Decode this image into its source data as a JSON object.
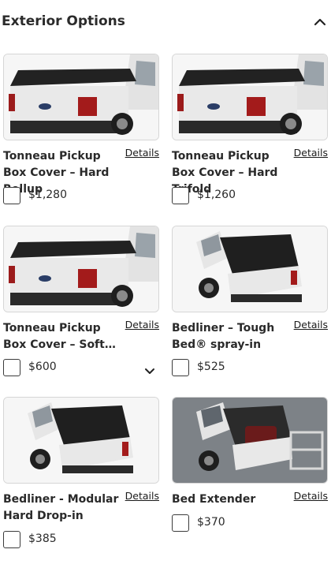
{
  "section": {
    "title": "Exterior Options"
  },
  "options": [
    {
      "name": "Tonneau Pickup Box Cover – Hard Rollup",
      "details_label": "Details",
      "price": "$1,280",
      "image": "tonneau-cover-photo"
    },
    {
      "name": "Tonneau Pickup Box Cover – Hard Trifold",
      "details_label": "Details",
      "price": "$1,260",
      "image": "tonneau-cover-photo"
    },
    {
      "name": "Tonneau Pickup Box Cover – Soft…",
      "details_label": "Details",
      "price": "$600",
      "image": "tonneau-cover-photo"
    },
    {
      "name": "Bedliner – Tough Bed® spray-in",
      "details_label": "Details",
      "price": "$525",
      "image": "bedliner-truck-photo"
    },
    {
      "name": "Bedliner - Modular Hard Drop-in",
      "details_label": "Details",
      "price": "$385",
      "image": "bedliner-truck-photo"
    },
    {
      "name": "Bed Extender",
      "details_label": "Details",
      "price": "$370",
      "image": "bed-extender-photo"
    }
  ],
  "icons": {
    "collapse": "chevron-up-icon",
    "expand": "chevron-down-icon"
  }
}
